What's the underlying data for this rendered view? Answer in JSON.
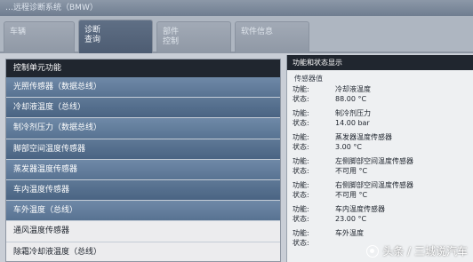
{
  "window": {
    "title": "…远程诊断系统（BMW）"
  },
  "tabs": [
    {
      "lines": [
        "车辆",
        ""
      ]
    },
    {
      "lines": [
        "诊断",
        "查询"
      ]
    },
    {
      "lines": [
        "部件",
        "控制"
      ]
    },
    {
      "lines": [
        "软件信息",
        ""
      ]
    }
  ],
  "left": {
    "header": "控制单元功能",
    "items": [
      "光照传感器（数据总线）",
      "冷却液温度（总线）",
      "制冷剂压力（数据总线）",
      "脚部空间温度传感器",
      "蒸发器温度传感器",
      "车内温度传感器",
      "车外温度（总线）",
      "通风温度传感器",
      "除霜冷却液温度（总线）"
    ]
  },
  "right": {
    "header": "功能和状态显示",
    "section_title": "传感器值",
    "signals": [
      {
        "function_label": "功能:",
        "function": "冷却液温度",
        "status_label": "状态:",
        "status": "88.00 °C"
      },
      {
        "function_label": "功能:",
        "function": "制冷剂压力",
        "status_label": "状态:",
        "status": "14.00 bar"
      },
      {
        "function_label": "功能:",
        "function": "蒸发器温度传感器",
        "status_label": "状态:",
        "status": "3.00 °C"
      },
      {
        "function_label": "功能:",
        "function": "左侧脚部空间温度传感器",
        "status_label": "状态:",
        "status": "不可用 °C"
      },
      {
        "function_label": "功能:",
        "function": "右侧脚部空间温度传感器",
        "status_label": "状态:",
        "status": "不可用 °C"
      },
      {
        "function_label": "功能:",
        "function": "车内温度传感器",
        "status_label": "状态:",
        "status": "23.00 °C"
      },
      {
        "function_label": "功能:",
        "function": "车外温度",
        "status_label": "状态:",
        "status": ""
      }
    ]
  },
  "watermark": {
    "text": "头条 / 三城说汽车"
  }
}
